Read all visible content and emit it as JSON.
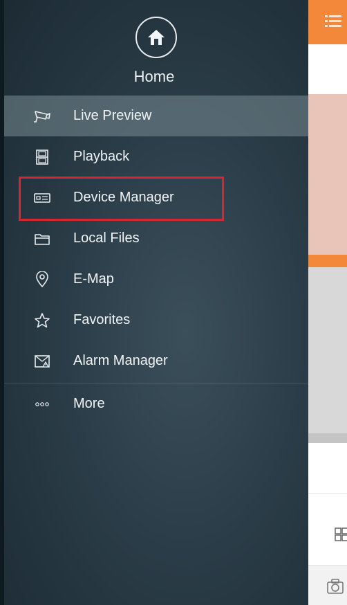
{
  "drawer": {
    "home_label": "Home",
    "menu": [
      {
        "id": "live-preview",
        "label": "Live Preview",
        "icon": "camera-icon",
        "active": true
      },
      {
        "id": "playback",
        "label": "Playback",
        "icon": "film-icon",
        "active": false
      },
      {
        "id": "device-manager",
        "label": "Device Manager",
        "icon": "device-icon",
        "active": false,
        "highlighted": true
      },
      {
        "id": "local-files",
        "label": "Local Files",
        "icon": "folder-icon",
        "active": false
      },
      {
        "id": "e-map",
        "label": "E-Map",
        "icon": "location-pin-icon",
        "active": false
      },
      {
        "id": "favorites",
        "label": "Favorites",
        "icon": "star-icon",
        "active": false
      },
      {
        "id": "alarm-manager",
        "label": "Alarm Manager",
        "icon": "alarm-envelope-icon",
        "active": false
      },
      {
        "id": "more",
        "label": "More",
        "icon": "more-dots-icon",
        "active": false
      }
    ]
  },
  "colors": {
    "accent_orange": "#f4883a",
    "highlight_red": "#d6262f",
    "drawer_bg": "#2b3d48",
    "active_item_bg": "#6f8088"
  }
}
